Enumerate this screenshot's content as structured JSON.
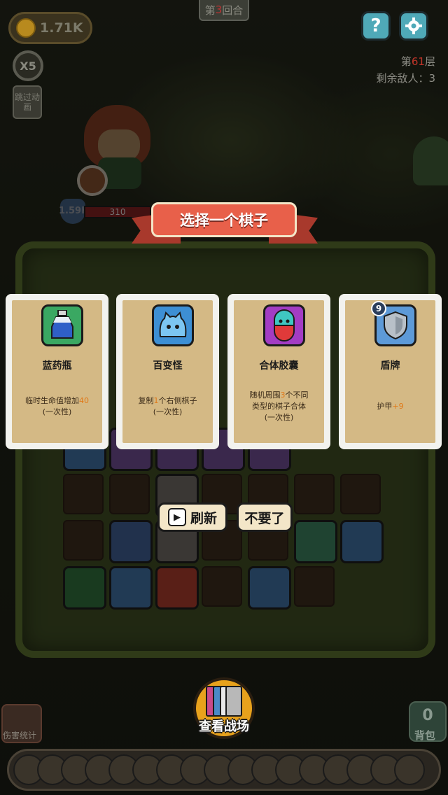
{
  "hud": {
    "coins": "1.71K",
    "round_prefix": "第",
    "round_number": "3",
    "round_suffix": "回合",
    "help_label": "?",
    "settings_icon": "gear-icon",
    "floor_prefix": "第",
    "floor_number": "61",
    "floor_suffix": "层",
    "enemies_label": "剩余敌人：3",
    "speed_label": "X5",
    "skip_anim_label": "跳过动画"
  },
  "hero": {
    "shield_value": "1.59K",
    "hp_value": "310"
  },
  "dialog": {
    "title": "选择一个棋子",
    "cards": [
      {
        "name": "蓝药瓶",
        "icon": "blue-potion-icon",
        "icon_color": "#3aa862",
        "desc_prefix": "临时生命值增加",
        "desc_highlight": "40",
        "desc_suffix": "",
        "desc_note": "(一次性)"
      },
      {
        "name": "百变怪",
        "icon": "blue-slime-icon",
        "icon_color": "#3d8fd4",
        "desc_prefix": "复制",
        "desc_highlight": "1",
        "desc_suffix": "个右侧棋子",
        "desc_note": "(一次性)"
      },
      {
        "name": "合体胶囊",
        "icon": "capsule-icon",
        "icon_color": "#a33cc4",
        "desc_line1_prefix": "随机周围",
        "desc_highlight": "3",
        "desc_line1_suffix": "个不同",
        "desc_line2": "类型的棋子合体",
        "desc_note": "(一次性)"
      },
      {
        "name": "盾牌",
        "icon": "shield-icon",
        "icon_color": "#5d9ad8",
        "level": "9",
        "desc_prefix": "护甲",
        "desc_highlight": "+9",
        "desc_suffix": ""
      }
    ],
    "refresh_label": "刷新",
    "skip_label": "不要了"
  },
  "bottom": {
    "battlefield_label": "查看战场",
    "damage_stats_label": "伤害统计",
    "bag_count": "0",
    "bag_label": "背包"
  },
  "colors": {
    "accent_orange": "#e07a1a",
    "banner": "#e8604a",
    "card_paper": "#d4b985"
  }
}
